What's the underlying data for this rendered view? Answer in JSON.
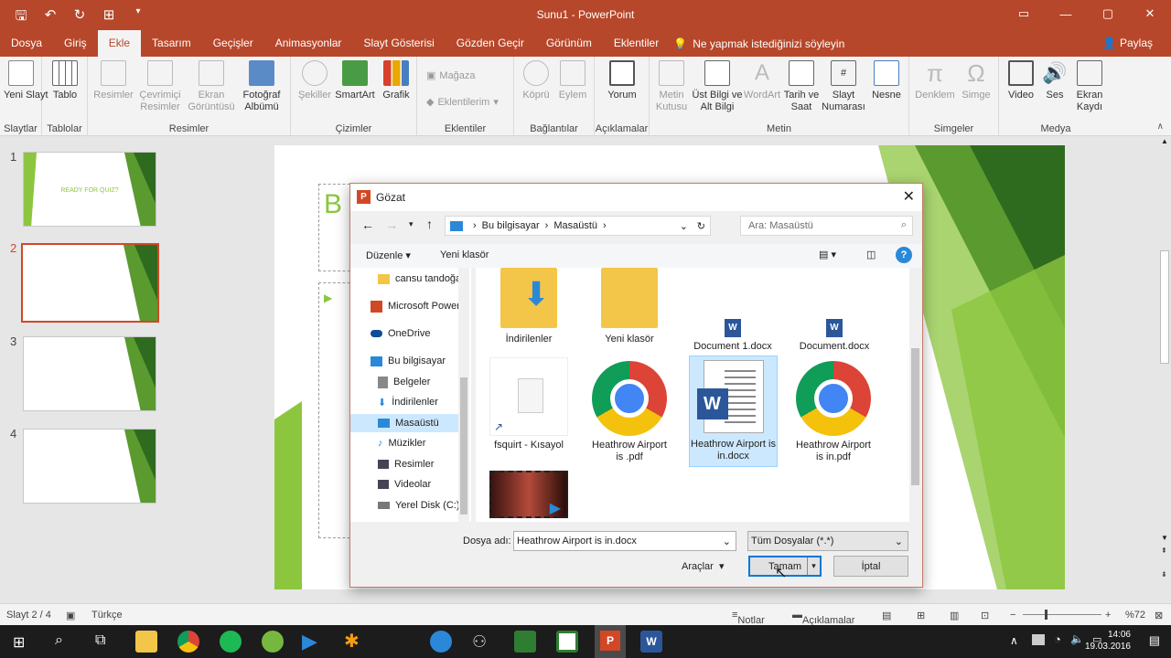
{
  "app": {
    "title": "Sunu1 - PowerPoint"
  },
  "tabs": [
    "Dosya",
    "Giriş",
    "Ekle",
    "Tasarım",
    "Geçişler",
    "Animasyonlar",
    "Slayt Gösterisi",
    "Gözden Geçir",
    "Görünüm",
    "Eklentiler"
  ],
  "tell_me": "Ne yapmak istediğinizi söyleyin",
  "share": "Paylaş",
  "ribbon": {
    "groups": [
      "Slaytlar",
      "Tablolar",
      "Resimler",
      "Çizimler",
      "Eklentiler",
      "Bağlantılar",
      "Açıklamalar",
      "Metin",
      "Simgeler",
      "Medya"
    ],
    "buttons": {
      "yeni_slayt": "Yeni Slayt",
      "tablo": "Tablo",
      "resimler": "Resimler",
      "cevrimici": "Çevrimiçi Resimler",
      "ekran": "Ekran Görüntüsü",
      "fotograf": "Fotoğraf Albümü",
      "sekiller": "Şekiller",
      "smartart": "SmartArt",
      "grafik": "Grafik",
      "magaza": "Mağaza",
      "eklentilerim": "Eklentilerim",
      "kopru": "Köprü",
      "eylem": "Eylem",
      "yorum": "Yorum",
      "metin_kutusu": "Metin Kutusu",
      "ust_bilgi": "Üst Bilgi ve Alt Bilgi",
      "wordart": "WordArt",
      "tarih": "Tarih ve Saat",
      "slayt_no": "Slayt Numarası",
      "nesne": "Nesne",
      "denklem": "Denklem",
      "simge": "Simge",
      "video": "Video",
      "ses": "Ses",
      "ekran_kaydi": "Ekran Kaydı"
    }
  },
  "thumbnails": [
    {
      "num": "1",
      "text": "READY FOR QUIZ?"
    },
    {
      "num": "2",
      "text": ""
    },
    {
      "num": "3",
      "text": ""
    },
    {
      "num": "4",
      "text": ""
    }
  ],
  "slide": {
    "title_initial": "B"
  },
  "dialog": {
    "title": "Gözat",
    "breadcrumb": [
      "Bu bilgisayar",
      "Masaüstü"
    ],
    "search_placeholder": "Ara: Masaüstü",
    "organize": "Düzenle",
    "new_folder": "Yeni klasör",
    "nav": [
      "cansu tandoğan",
      "Microsoft PowerP",
      "OneDrive",
      "Bu bilgisayar",
      "Belgeler",
      "İndirilenler",
      "Masaüstü",
      "Müzikler",
      "Resimler",
      "Videolar",
      "Yerel Disk (C:)"
    ],
    "files": [
      "İndirilenler",
      "Yeni klasör",
      "Document 1.docx",
      "Document.docx",
      "fsquirt - Kısayol",
      "Heathrow Airport is .pdf",
      "Heathrow Airport is in.docx",
      "Heathrow Airport is in.pdf"
    ],
    "filename_label": "Dosya adı:",
    "filename_value": "Heathrow Airport is in.docx",
    "filter": "Tüm Dosyalar (*.*)",
    "tools": "Araçlar",
    "ok": "Tamam",
    "cancel": "İptal"
  },
  "status": {
    "slide": "Slayt 2 / 4",
    "lang": "Türkçe",
    "notes": "Notlar",
    "comments": "Açıklamalar",
    "zoom": "%72"
  },
  "clock": {
    "time": "14:06",
    "date": "19.03.2016"
  },
  "colors": {
    "accent": "#b7472a",
    "green": "#8cc63f"
  }
}
